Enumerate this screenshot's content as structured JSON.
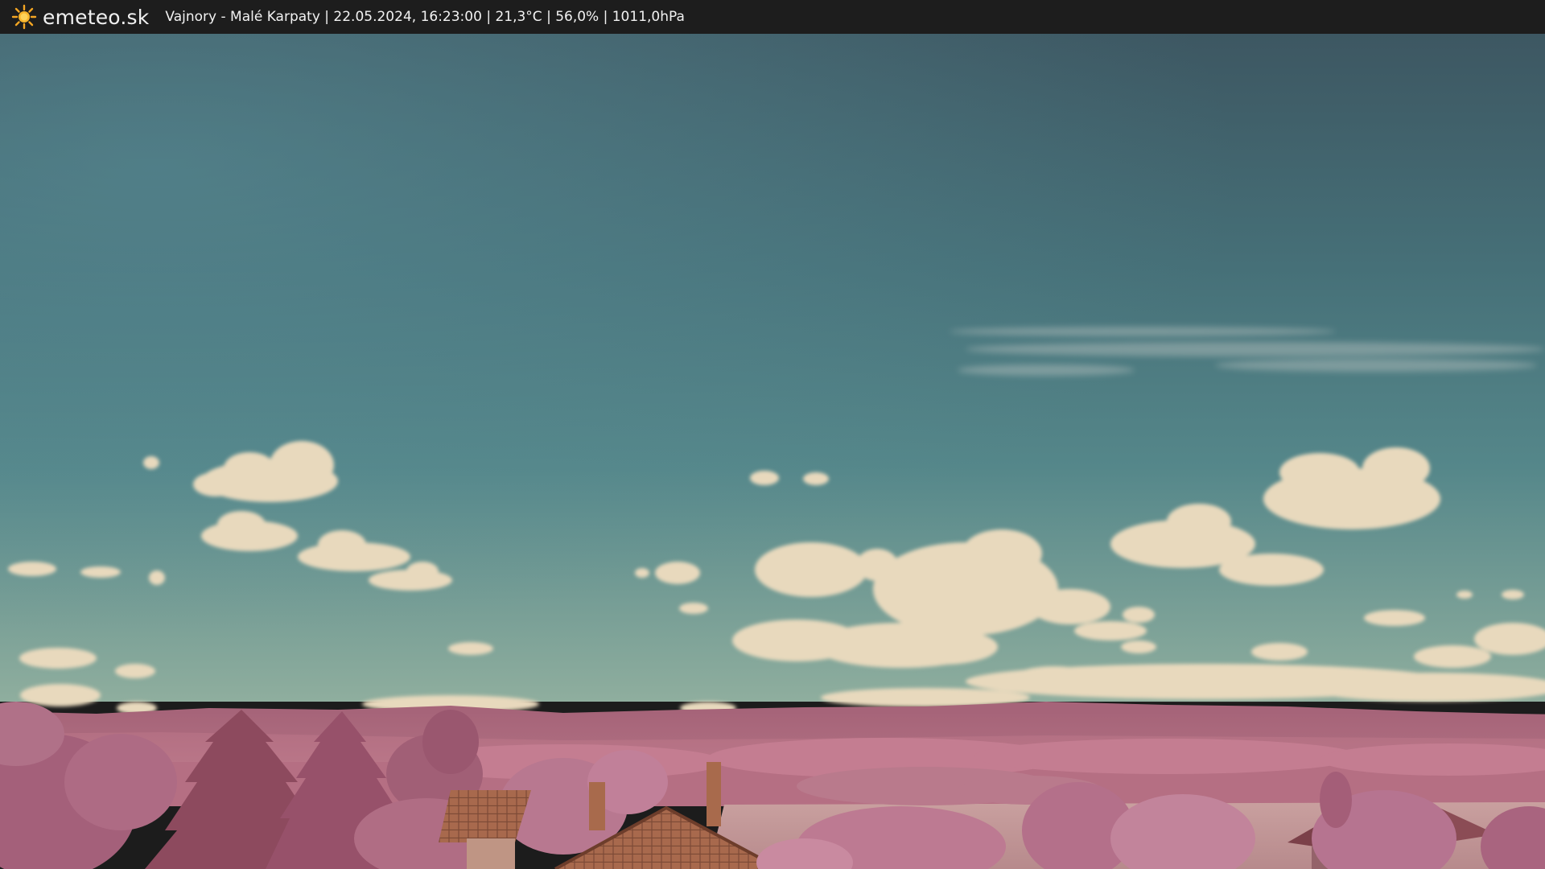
{
  "header": {
    "brand": "emeteo.sk",
    "brand_icon": "sun-icon",
    "status": "Vajnory - Malé Karpaty | 22.05.2024, 16:23:00 | 21,3°C | 56,0% | 1011,0hPa"
  },
  "scene": {
    "description_icon": "webcam-infrared-landscape",
    "colors": {
      "sky_top": "#3c5560",
      "sky_mid": "#4f8087",
      "sky_horizon": "#86a79b",
      "cloud": "#eadcc0",
      "foliage": "#b06a7c",
      "foliage_dark": "#8c4a5c",
      "field": "#c79a98",
      "roof": "#a56a4d"
    }
  }
}
